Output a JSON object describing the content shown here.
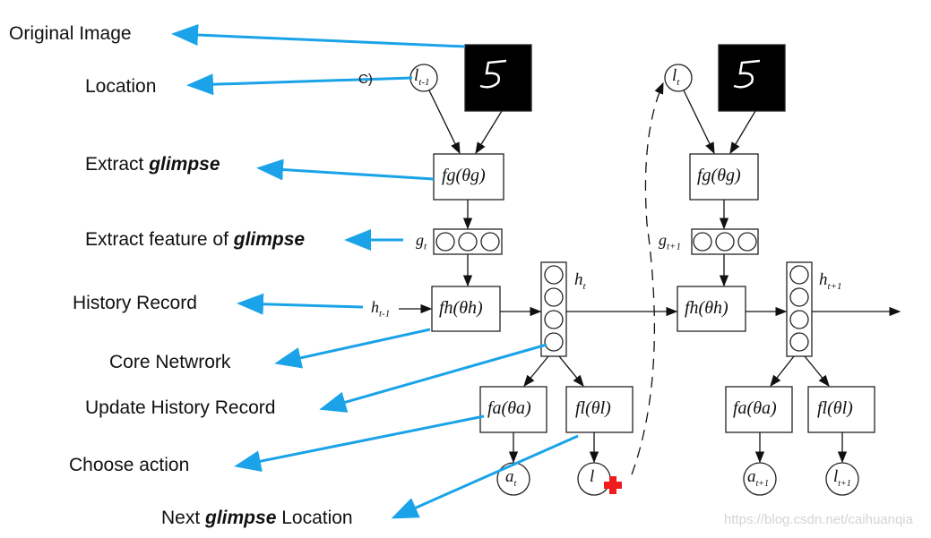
{
  "labels": {
    "original_image": "Original Image",
    "location": "Location",
    "extract_glimpse_prefix": "Extract ",
    "extract_glimpse_em": "glimpse",
    "extract_feature_prefix": "Extract feature of ",
    "extract_feature_em": "glimpse",
    "history_record": "History Record",
    "core_network": "Core  Netwrork",
    "update_history": "Update History Record",
    "choose_action": "Choose action",
    "next_prefix": "Next ",
    "next_em": "glimpse",
    "next_suffix": " Location",
    "stray_mark": "C)"
  },
  "nodes": {
    "l_prev": "l",
    "l_prev_sub": "t-1",
    "l_t": "l",
    "l_t_sub": "t",
    "fg": "fg(θg)",
    "g_t": "g",
    "g_t_sub": "t",
    "g_next": "g",
    "g_next_sub": "t+1",
    "h_prev": "h",
    "h_prev_sub": "t-1",
    "fh": "fh(θh)",
    "h_t": "h",
    "h_t_sub": "t",
    "h_next": "h",
    "h_next_sub": "t+1",
    "fa": "fa(θa)",
    "fl": "fl(θl)",
    "a_t": "a",
    "a_t_sub": "t",
    "l_out": "l",
    "a_next": "a",
    "a_next_sub": "t+1",
    "l_next": "l",
    "l_next_sub": "t+1"
  },
  "colors": {
    "annotation_arrow": "#1aa3e8",
    "cross": "#ee1c1c"
  },
  "watermark": "https://blog.csdn.net/caihuanqia"
}
